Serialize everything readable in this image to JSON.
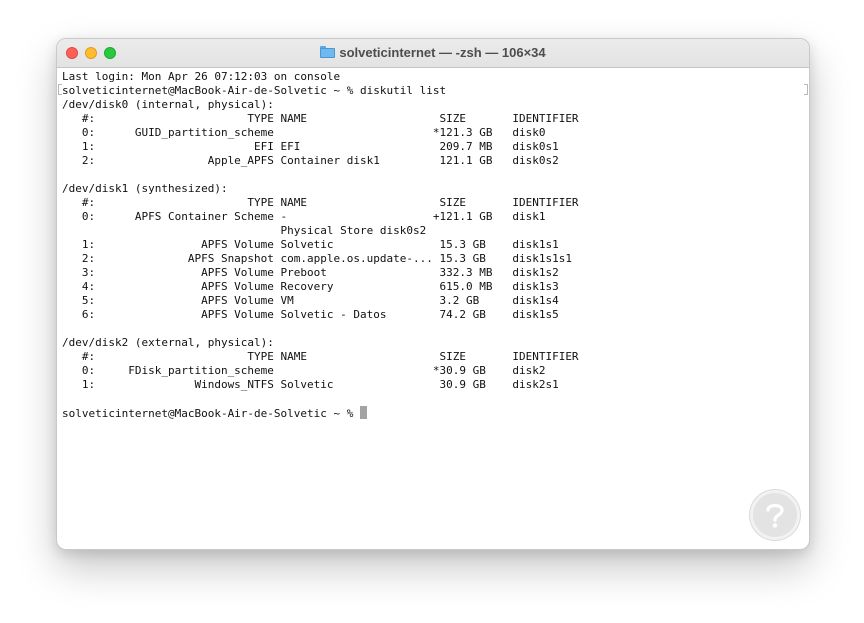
{
  "window": {
    "title": "solveticinternet — -zsh — 106×34"
  },
  "terminal": {
    "lines": [
      "Last login: Mon Apr 26 07:12:03 on console",
      "solveticinternet@MacBook-Air-de-Solvetic ~ % diskutil list",
      "/dev/disk0 (internal, physical):",
      "   #:                       TYPE NAME                    SIZE       IDENTIFIER",
      "   0:      GUID_partition_scheme                        *121.3 GB   disk0",
      "   1:                        EFI EFI                     209.7 MB   disk0s1",
      "   2:                 Apple_APFS Container disk1         121.1 GB   disk0s2",
      "",
      "/dev/disk1 (synthesized):",
      "   #:                       TYPE NAME                    SIZE       IDENTIFIER",
      "   0:      APFS Container Scheme -                      +121.1 GB   disk1",
      "                                 Physical Store disk0s2",
      "   1:                APFS Volume Solvetic                15.3 GB    disk1s1",
      "   2:              APFS Snapshot com.apple.os.update-... 15.3 GB    disk1s1s1",
      "   3:                APFS Volume Preboot                 332.3 MB   disk1s2",
      "   4:                APFS Volume Recovery                615.0 MB   disk1s3",
      "   5:                APFS Volume VM                      3.2 GB     disk1s4",
      "   6:                APFS Volume Solvetic - Datos        74.2 GB    disk1s5",
      "",
      "/dev/disk2 (external, physical):",
      "   #:                       TYPE NAME                    SIZE       IDENTIFIER",
      "   0:     FDisk_partition_scheme                        *30.9 GB    disk2",
      "   1:               Windows_NTFS Solvetic                30.9 GB    disk2s1",
      ""
    ],
    "prompt": "solveticinternet@MacBook-Air-de-Solvetic ~ % "
  }
}
